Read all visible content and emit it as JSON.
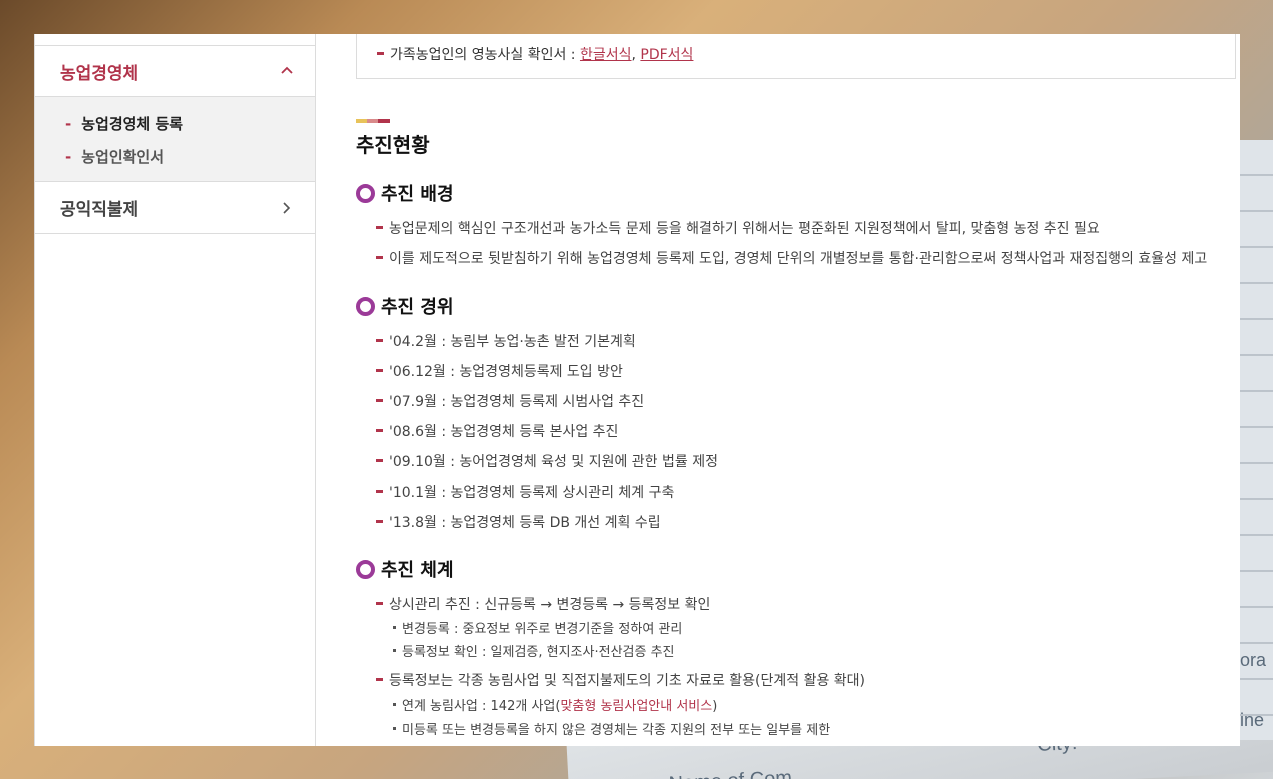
{
  "colors": {
    "accent": "#b1344b",
    "ring": "#9b3a98",
    "deco": [
      "#e8c35a",
      "#d98a8a",
      "#b1344b"
    ]
  },
  "background": {
    "paper_city": "City:",
    "paper_name": "Name of Com",
    "paper_ora": "ora",
    "paper_ine": "ine"
  },
  "sidebar": {
    "menu1": {
      "label": "농업경영체",
      "icon": "chevron-up-icon",
      "expanded": true
    },
    "submenu": [
      {
        "label": "농업경영체 등록",
        "active": true
      },
      {
        "label": "농업인확인서",
        "active": false
      }
    ],
    "menu2": {
      "label": "공익직불제",
      "icon": "chevron-right-icon"
    }
  },
  "top_item": {
    "text": "가족농업인의 영농사실 확인서 : ",
    "link1": "한글서식",
    "sep": ", ",
    "link2": "PDF서식"
  },
  "section": {
    "title": "추진현황",
    "background": {
      "heading": "추진 배경",
      "items": [
        "농업문제의 핵심인 구조개선과 농가소득 문제 등을 해결하기 위해서는 평준화된 지원정책에서 탈피, 맞춤형 농정 추진 필요",
        "이를 제도적으로 뒷받침하기 위해 농업경영체 등록제 도입, 경영체 단위의 개별정보를 통합·관리함으로써 정책사업과 재정집행의 효율성 제고"
      ]
    },
    "history": {
      "heading": "추진 경위",
      "items": [
        "'04.2월 : 농림부 농업·농촌 발전 기본계획",
        "'06.12월 : 농업경영체등록제 도입 방안",
        "'07.9월 : 농업경영체 등록제 시범사업 추진",
        "'08.6월 : 농업경영체 등록 본사업 추진",
        "'09.10월 : 농어업경영체 육성 및 지원에 관한 법률 제정",
        "'10.1월 : 농업경영체 등록제 상시관리 체계 구축",
        "'13.8월 : 농업경영체 등록 DB 개선 계획 수립"
      ]
    },
    "system": {
      "heading": "추진 체계",
      "item1": "상시관리 추진 : 신규등록 → 변경등록 → 등록정보 확인",
      "item1_subs": [
        "변경등록 : 중요정보 위주로 변경기준을 정하여 관리",
        "등록정보 확인 : 일제검증, 현지조사·전산검증 추진"
      ],
      "item2": "등록정보는 각종 농림사업 및 직접지불제도의 기초 자료로 활용(단계적 활용 확대)",
      "item2_sub1_prefix": "연계 농림사업 : 142개 사업(",
      "item2_sub1_link": "맞춤형 농림사업안내 서비스",
      "item2_sub1_suffix": ")",
      "item2_sub2": "미등록 또는 변경등록을 하지 않은 경영체는 각종 지원의 전부 또는 일부를 제한"
    }
  }
}
